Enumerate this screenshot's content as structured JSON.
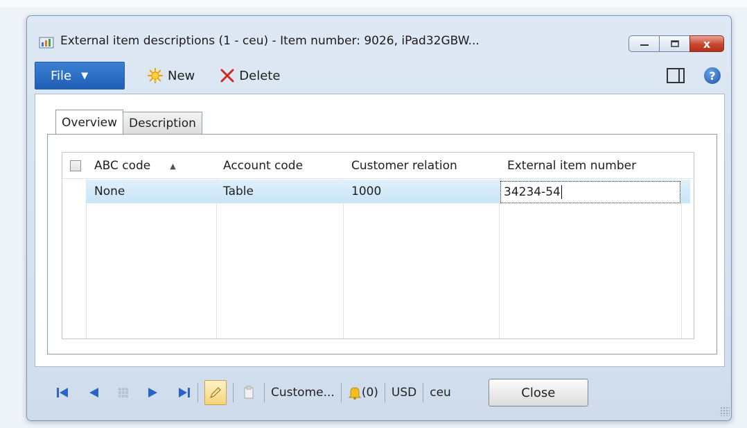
{
  "window": {
    "title": "External item descriptions (1 - ceu) - Item number: 9026, iPad32GBW...",
    "caption_close": "x"
  },
  "ribbon": {
    "file_label": "File",
    "new_label": "New",
    "delete_label": "Delete",
    "help_label": "?"
  },
  "tabs": [
    {
      "label": "Overview"
    },
    {
      "label": "Description"
    }
  ],
  "grid": {
    "columns": [
      "ABC code",
      "Account code",
      "Customer relation",
      "External item number"
    ],
    "rows": [
      {
        "abc_code": "None",
        "account_code": "Table",
        "customer_relation": "1000",
        "external_item_number": "34234-54"
      }
    ]
  },
  "statusbar": {
    "company_short": "Custome...",
    "notifications": "(0)",
    "currency": "USD",
    "company": "ceu",
    "close_label": "Close"
  },
  "colors": {
    "file_button": "#1f5fb6",
    "selected_row": "#c9e5f7",
    "close_caption": "#c8452d"
  }
}
